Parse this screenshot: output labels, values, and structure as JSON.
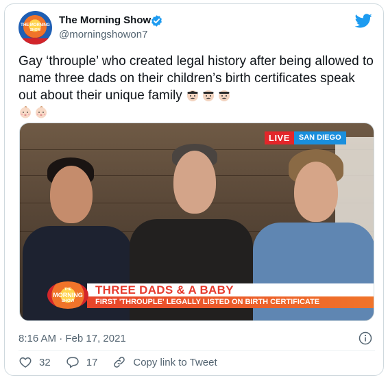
{
  "author": {
    "display_name": "The Morning Show",
    "handle": "@morningshowon7",
    "avatar_text_line1": "THE MORNING",
    "avatar_text_line2": "SHOW"
  },
  "tweet": {
    "text": "Gay ‘throuple’ who created legal history after being allowed to name three dads on their children’s birth certificates speak out about their unique family",
    "emojis": [
      "man-emoji",
      "man-emoji",
      "man-emoji",
      "baby-emoji",
      "baby-emoji"
    ]
  },
  "media": {
    "live_label": "LIVE",
    "location_label": "SAN DIEGO",
    "show_logo_line1": "THE",
    "show_logo_line2": "MORNING",
    "show_logo_line3": "SHOW",
    "headline": "THREE DADS & A BABY",
    "subheadline": "FIRST 'THROUPLE' LEGALLY LISTED ON BIRTH CERTIFICATE"
  },
  "timestamp": "8:16 AM · Feb 17, 2021",
  "actions": {
    "like_count": "32",
    "reply_count": "17",
    "copy_link_label": "Copy link to Tweet"
  },
  "colors": {
    "verified": "#1d9bf0",
    "twitter_blue": "#1d9bf0",
    "secondary_text": "#536471",
    "live_red": "#e3262a",
    "location_blue": "#1a8fdd",
    "headline_red": "#e63b2e"
  }
}
